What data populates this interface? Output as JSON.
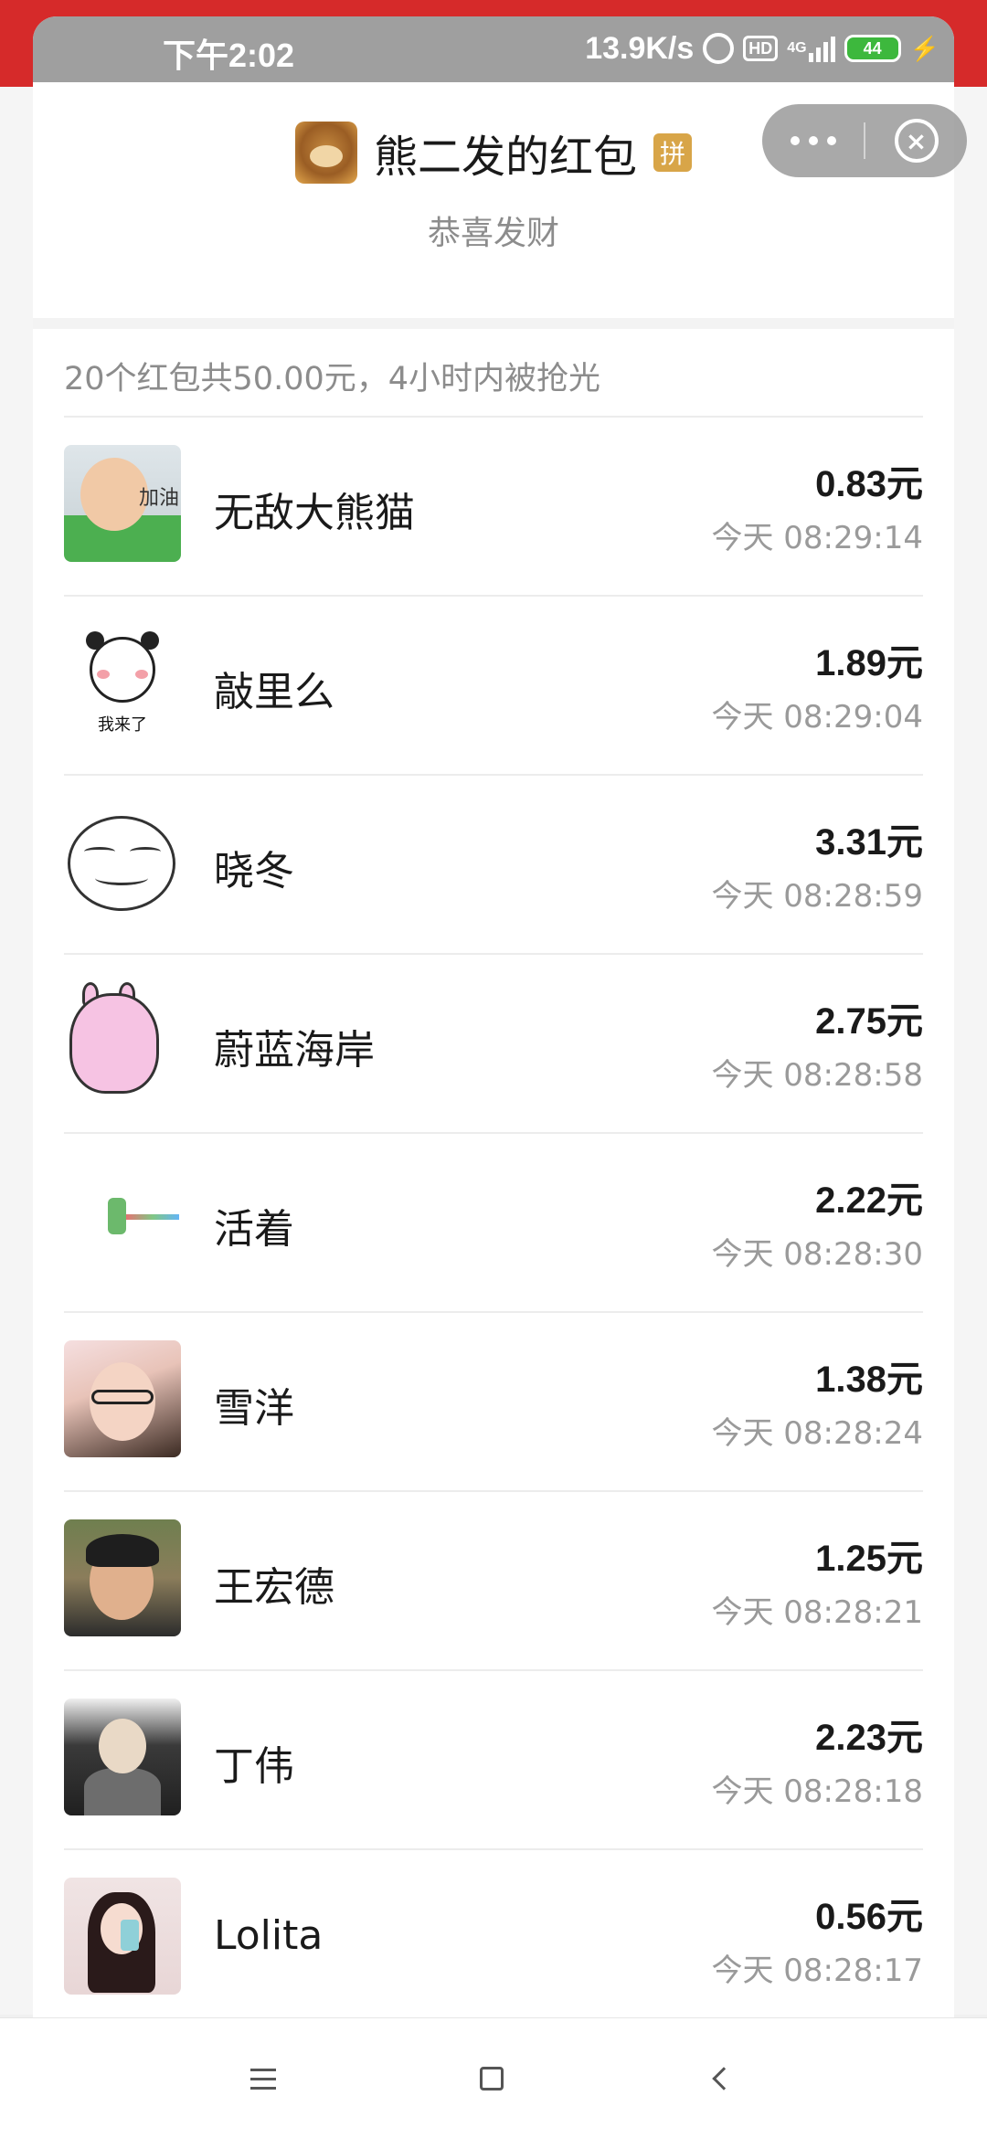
{
  "status_bar": {
    "time": "下午2:02",
    "net_speed": "13.9K/s",
    "network": "4G",
    "battery": "44"
  },
  "header": {
    "title": "熊二发的红包",
    "badge": "拼",
    "subtitle": "恭喜发财"
  },
  "summary": "20个红包共50.00元，4小时内被抢光",
  "avatar_texts": {
    "baby": "加油",
    "panda": "我来了"
  },
  "records": [
    {
      "name": "无敌大熊猫",
      "amount": "0.83元",
      "time": "今天 08:29:14"
    },
    {
      "name": "敲里么",
      "amount": "1.89元",
      "time": "今天 08:29:04"
    },
    {
      "name": "晓冬",
      "amount": "3.31元",
      "time": "今天 08:28:59"
    },
    {
      "name": "蔚蓝海岸",
      "amount": "2.75元",
      "time": "今天 08:28:58"
    },
    {
      "name": "活着",
      "amount": "2.22元",
      "time": "今天 08:28:30"
    },
    {
      "name": "雪洋",
      "amount": "1.38元",
      "time": "今天 08:28:24"
    },
    {
      "name": "王宏德",
      "amount": "1.25元",
      "time": "今天 08:28:21"
    },
    {
      "name": "丁伟",
      "amount": "2.23元",
      "time": "今天 08:28:18"
    },
    {
      "name": "Lolita",
      "amount": "0.56元",
      "time": "今天 08:28:17"
    }
  ]
}
